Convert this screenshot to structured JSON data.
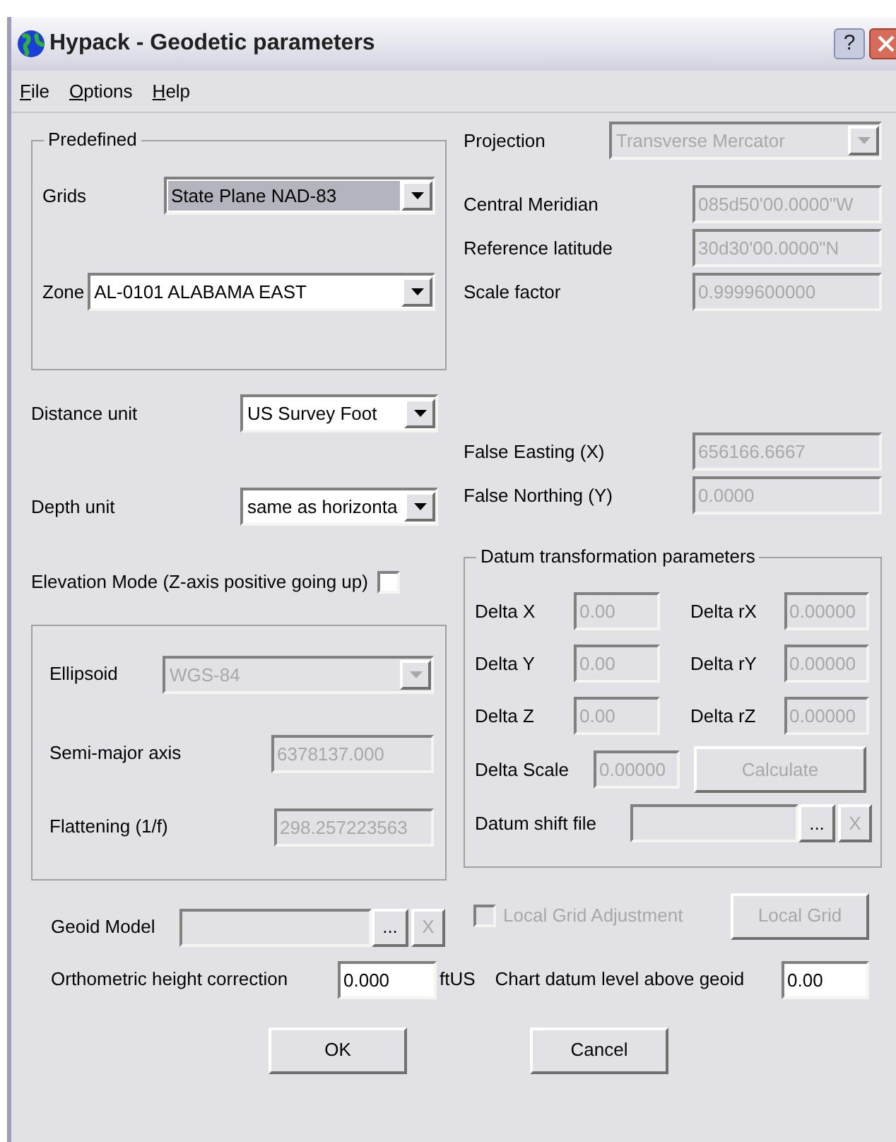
{
  "window": {
    "title": "Hypack - Geodetic parameters",
    "help_button": "?"
  },
  "menu": [
    "File",
    "Options",
    "Help"
  ],
  "predefined": {
    "legend": "Predefined",
    "grids": {
      "label": "Grids",
      "value": "State Plane NAD-83",
      "focused": true
    },
    "zone": {
      "label": "Zone",
      "value": "AL-0101 ALABAMA EAST"
    }
  },
  "distance_unit": {
    "label": "Distance unit",
    "value": "US Survey Foot"
  },
  "depth_unit": {
    "label": "Depth unit",
    "value": "same as horizonta"
  },
  "elevation_mode": {
    "label": "Elevation Mode (Z-axis positive going up)",
    "checked": false
  },
  "ellipsoid": {
    "label": "Ellipsoid",
    "value": "WGS-84",
    "disabled": true
  },
  "semi_major_axis": {
    "label": "Semi-major axis",
    "value": "6378137.000",
    "disabled": true
  },
  "flattening": {
    "label": "Flattening (1/f)",
    "value": "298.257223563",
    "disabled": true
  },
  "projection": {
    "label": "Projection",
    "value": "Transverse Mercator",
    "disabled": true
  },
  "projection_params": [
    {
      "label": "Central Meridian",
      "value": "085d50'00.0000\"W",
      "disabled": true
    },
    {
      "label": "Reference latitude",
      "value": "30d30'00.0000\"N",
      "disabled": true
    },
    {
      "label": "Scale factor",
      "value": "0.9999600000",
      "disabled": true
    }
  ],
  "false_origin": [
    {
      "label": "False Easting (X)",
      "value": "656166.6667",
      "disabled": true
    },
    {
      "label": "False Northing (Y)",
      "value": "0.0000",
      "disabled": true
    }
  ],
  "datum_transformation": {
    "legend": "Datum transformation parameters",
    "deltas": [
      {
        "label": "Delta X",
        "value": "0.00",
        "disabled": true
      },
      {
        "label": "Delta rX",
        "value": "0.00000",
        "disabled": true
      },
      {
        "label": "Delta Y",
        "value": "0.00",
        "disabled": true
      },
      {
        "label": "Delta rY",
        "value": "0.00000",
        "disabled": true
      },
      {
        "label": "Delta Z",
        "value": "0.00",
        "disabled": true
      },
      {
        "label": "Delta rZ",
        "value": "0.00000",
        "disabled": true
      }
    ],
    "delta_scale": {
      "label": "Delta Scale",
      "value": "0.00000",
      "disabled": true
    },
    "calculate": {
      "label": "Calculate",
      "disabled": true
    },
    "datum_shift_file": {
      "label": "Datum shift file",
      "disabled": true,
      "browse": "...",
      "clear": "X"
    }
  },
  "geoid_model": {
    "label": "Geoid Model",
    "disabled": true,
    "browse": "...",
    "clear": "X"
  },
  "local_grid_adjustment": {
    "label": "Local Grid Adjustment",
    "checked": false,
    "disabled": true
  },
  "local_grid": {
    "label": "Local Grid",
    "disabled": true
  },
  "orthometric_height_correction": {
    "label": "Orthometric height correction",
    "value": "0.000",
    "unit": "ftUS"
  },
  "chart_datum_level": {
    "label": "Chart datum level above geoid",
    "value": "0.00"
  },
  "buttons": [
    "OK",
    "Cancel"
  ]
}
